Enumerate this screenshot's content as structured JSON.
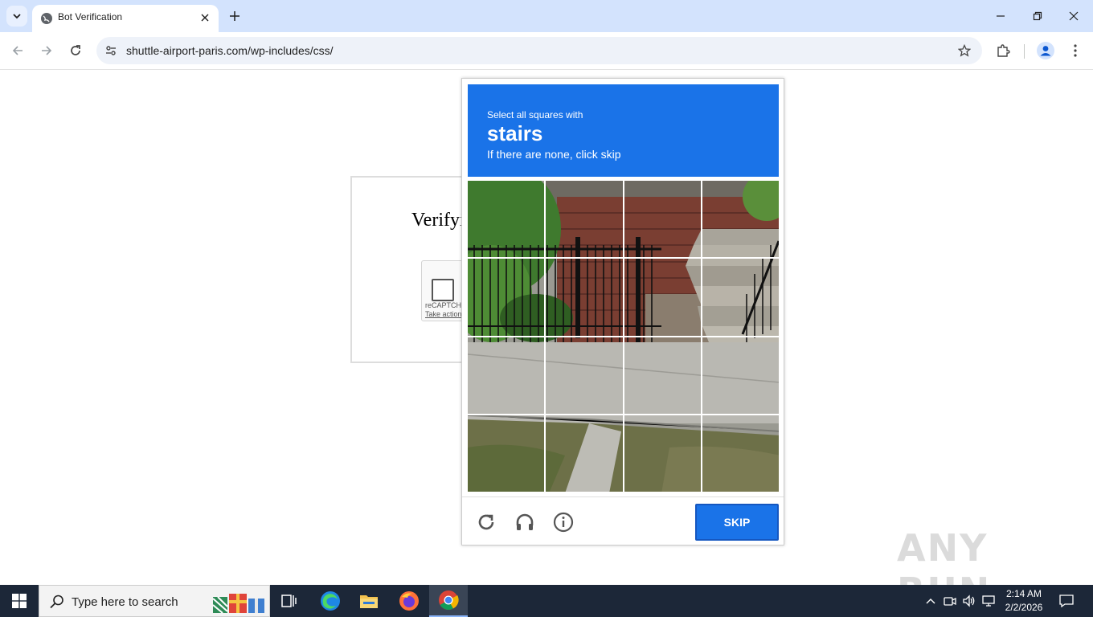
{
  "browser": {
    "tab_title": "Bot Verification",
    "url": "shuttle-airport-paris.com/wp-includes/css/"
  },
  "page": {
    "verify_title": "Verifyi",
    "recaptcha_label": "reCAPTCHA",
    "recaptcha_action": "Take action"
  },
  "challenge": {
    "line1": "Select all squares with",
    "object": "stairs",
    "line3": "If there are none, click skip",
    "skip_label": "SKIP",
    "tiles": 16
  },
  "watermark": "ANY RUN",
  "taskbar": {
    "search_placeholder": "Type here to search",
    "time": "2:14 AM",
    "date": "2/2/2026"
  },
  "colors": {
    "accent": "#1a73e8",
    "tabstrip": "#d3e3fd",
    "taskbar": "#1c2738"
  }
}
